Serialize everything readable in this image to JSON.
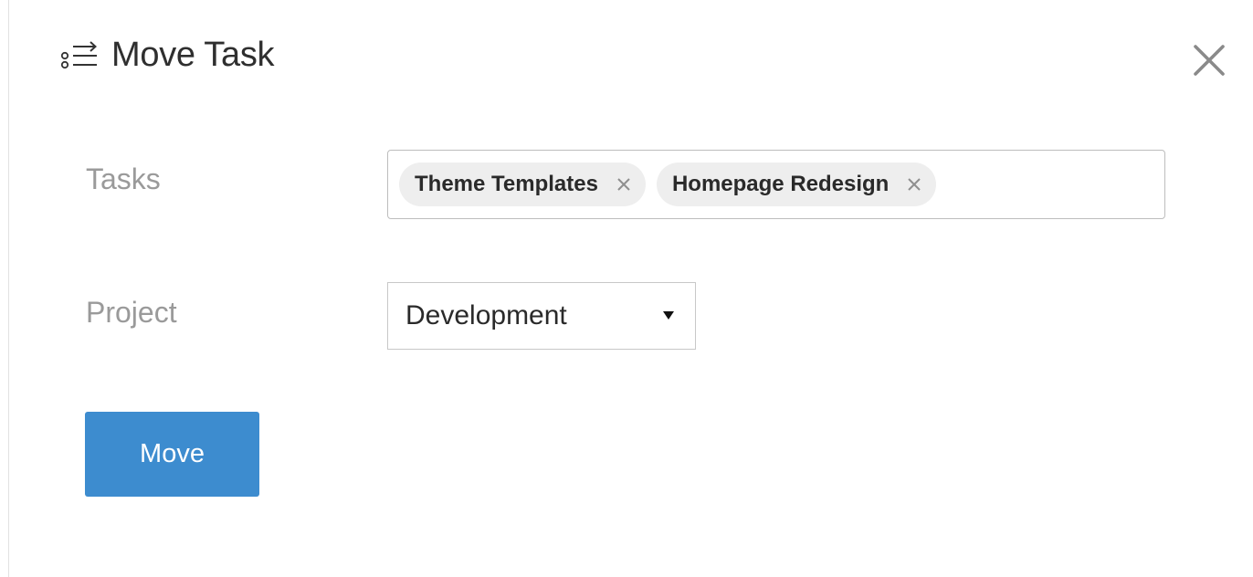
{
  "dialog": {
    "title": "Move Task",
    "title_icon": "move-task-icon",
    "close_icon": "close-icon"
  },
  "form": {
    "tasks_label": "Tasks",
    "project_label": "Project",
    "selected_tasks": [
      {
        "label": "Theme Templates",
        "remove_icon": "close-icon"
      },
      {
        "label": "Homepage Redesign",
        "remove_icon": "close-icon"
      }
    ],
    "project_value": "Development",
    "project_caret_icon": "caret-down-icon"
  },
  "actions": {
    "move_label": "Move",
    "move_color": "#3d8ccf"
  }
}
